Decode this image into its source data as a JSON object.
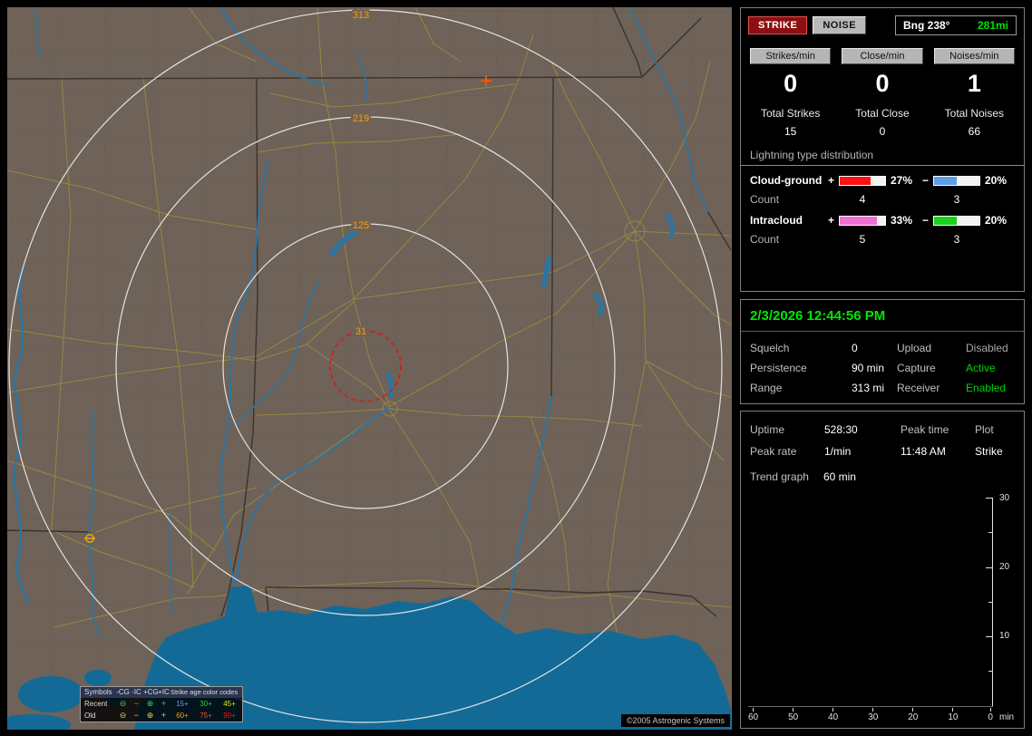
{
  "map": {
    "ring_labels": [
      "313",
      "219",
      "125",
      "31"
    ],
    "ring_label_color": "#ff9a00",
    "legend": {
      "symbols_header": "Symbols",
      "col_headers": [
        "-CG",
        "-IC",
        "+CG",
        "+IC"
      ],
      "glyphs": [
        "⊖",
        "−",
        "⊕",
        "+"
      ],
      "age_header": "Strike age color codes",
      "recent_label": "Recent",
      "old_label": "Old",
      "recent_glyph_color": "#34d178",
      "old_glyph_color": "#e2cf4e",
      "recent_ages": [
        {
          "text": "15+",
          "color": "#5aa0ff"
        },
        {
          "text": "30+",
          "color": "#33cc33"
        },
        {
          "text": "45+",
          "color": "#e8e800"
        }
      ],
      "old_ages": [
        {
          "text": "60+",
          "color": "#ff9900"
        },
        {
          "text": "75+",
          "color": "#ff4c2a"
        },
        {
          "text": "90+",
          "color": "#ff1111"
        }
      ]
    },
    "copyright": "©2005 Astrogenic Systems"
  },
  "sidebar": {
    "toggles": {
      "strike": "STRIKE",
      "noise": "NOISE"
    },
    "bearing": {
      "label": "Bng 238°",
      "range": "281mi",
      "range_color": "#00e000"
    },
    "counters": [
      {
        "label": "Strikes/min",
        "rate": "0",
        "total_label": "Total Strikes",
        "total": "15"
      },
      {
        "label": "Close/min",
        "rate": "0",
        "total_label": "Total Close",
        "total": "0"
      },
      {
        "label": "Noises/min",
        "rate": "1",
        "total_label": "Total Noises",
        "total": "66"
      }
    ],
    "distribution": {
      "title": "Lightning type distribution",
      "count_label": "Count",
      "rows": [
        {
          "name": "Cloud-ground",
          "plus_sign": "+",
          "plus_pct": "27%",
          "plus_color": "#ff1111",
          "minus_sign": "−",
          "minus_pct": "20%",
          "minus_color": "#5c9fe8",
          "plus_count": "4",
          "minus_count": "3"
        },
        {
          "name": "Intracloud",
          "plus_sign": "+",
          "plus_pct": "33%",
          "plus_color": "#f26fd2",
          "minus_sign": "−",
          "minus_pct": "20%",
          "minus_color": "#19d219",
          "plus_count": "5",
          "minus_count": "3"
        }
      ]
    },
    "datetime": {
      "text": "2/3/2026 12:44:56 PM",
      "color": "#00e800"
    },
    "settings": [
      {
        "label": "Squelch",
        "value": "0",
        "label2": "Upload",
        "value2": "Disabled",
        "value2_color": "#a8a8a8"
      },
      {
        "label": "Persistence",
        "value": "90 min",
        "label2": "Capture",
        "value2": "Active",
        "value2_color": "#00d400"
      },
      {
        "label": "Range",
        "value": "313 mi",
        "label2": "Receiver",
        "value2": "Enabled",
        "value2_color": "#00d400"
      }
    ],
    "status": {
      "uptime_label": "Uptime",
      "uptime": "528:30",
      "peak_time_label": "Peak time",
      "peak_time": "11:48 AM",
      "plot_label": "Plot",
      "plot_value": "Strike",
      "peak_rate_label": "Peak rate",
      "peak_rate": "1/min",
      "trend_label": "Trend graph",
      "trend_value": "60 min"
    },
    "graph": {
      "x_ticks": [
        "60",
        "50",
        "40",
        "30",
        "20",
        "10",
        "0"
      ],
      "x_unit": "min",
      "y_ticks": [
        "30",
        "20",
        "10"
      ]
    }
  }
}
